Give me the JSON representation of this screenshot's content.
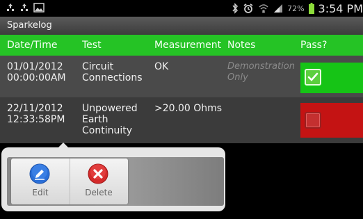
{
  "status_bar": {
    "battery_percent": "72%",
    "time": "3:54 PM",
    "icons": [
      "recycle-icon",
      "recycle-icon",
      "image-icon",
      "bluetooth-icon",
      "alarm-icon",
      "wifi-icon",
      "signal-icon",
      "battery-icon"
    ]
  },
  "app": {
    "title": "Sparkelog"
  },
  "table": {
    "headers": [
      "Date/Time",
      "Test",
      "Measurement",
      "Notes",
      "Pass?"
    ],
    "rows": [
      {
        "date": "01/01/2012",
        "time": "00:00:00AM",
        "test_lines": [
          "Circuit",
          "Connections"
        ],
        "measurement": "OK",
        "notes_lines": [
          "Demonstration",
          "Only"
        ],
        "pass": true
      },
      {
        "date": "22/11/2012",
        "time": "12:33:58PM",
        "test_lines": [
          "Unpowered",
          "Earth",
          "Continuity"
        ],
        "measurement": ">20.00 Ohms",
        "notes_lines": [],
        "pass": false
      }
    ]
  },
  "popup_menu": {
    "edit_label": "Edit",
    "delete_label": "Delete"
  },
  "colors": {
    "header_green": "#25c325",
    "pass_green": "#16c416",
    "fail_red": "#c41313",
    "edit_blue": "#2a6fd8",
    "delete_red": "#d42a2a"
  }
}
